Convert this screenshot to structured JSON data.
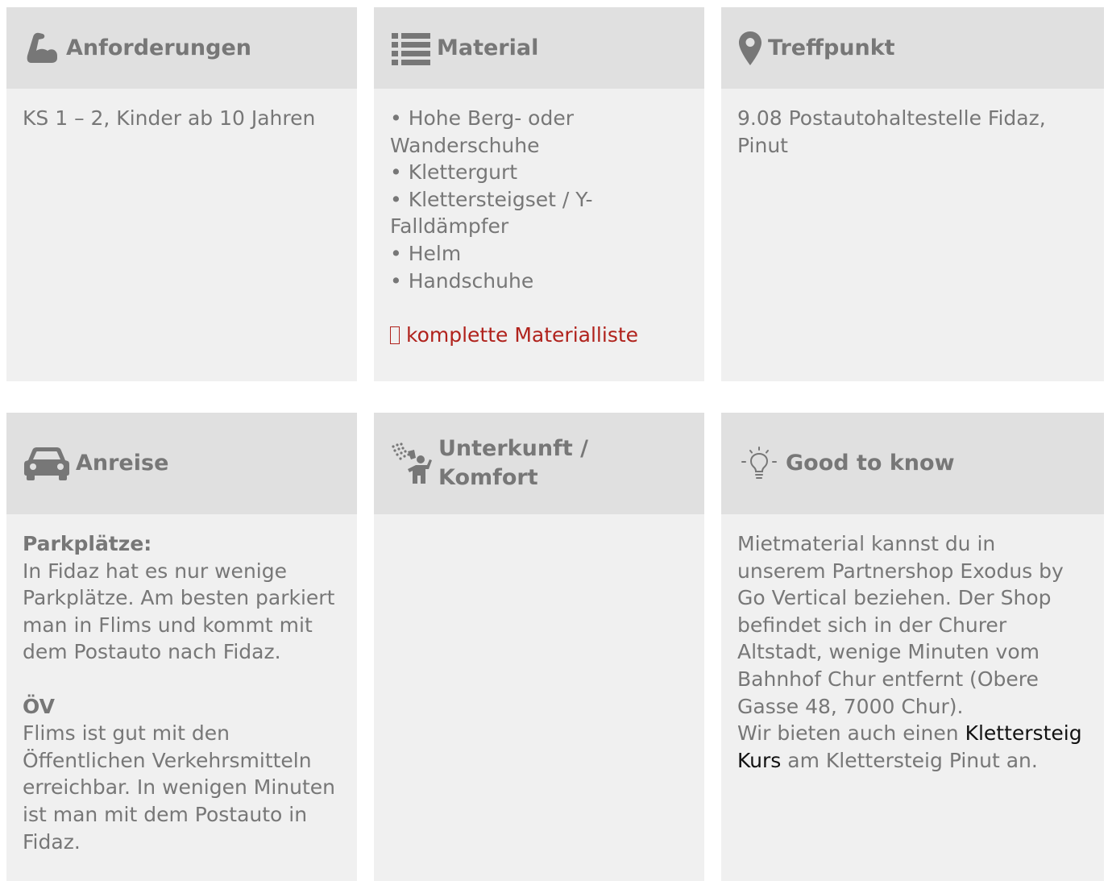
{
  "cards": {
    "anforderungen": {
      "title": "Anforderungen",
      "icon": "flexed-arm-icon",
      "text": "KS 1 – 2, Kinder ab 10 Jahren"
    },
    "material": {
      "title": "Material",
      "icon": "list-icon",
      "items": [
        "• Hohe Berg- oder Wanderschuhe",
        "• Klettergurt",
        "• Klettersteigset / Y-Falldämpfer",
        "• Helm",
        "• Handschuhe"
      ],
      "link_label": "komplette Materialliste",
      "link_icon": "missing-glyph-icon"
    },
    "treffpunkt": {
      "title": "Treffpunkt",
      "icon": "map-marker-icon",
      "text": "9.08 Postautohaltestelle Fidaz, Pinut"
    },
    "anreise": {
      "title": "Anreise",
      "icon": "car-icon",
      "parking_heading": "Parkplätze:",
      "parking_text": "In Fidaz hat es nur wenige Parkplätze. Am besten parkiert man in Flims und kommt mit dem Postauto nach Fidaz.",
      "oev_heading": "ÖV",
      "oev_text": "Flims ist gut mit den Öffentlichen Verkehrsmitteln erreichbar. In wenigen Minuten ist man mit dem Postauto in Fidaz."
    },
    "unterkunft": {
      "title": "Unterkunft / Komfort",
      "icon": "shower-icon"
    },
    "goodtoknow": {
      "title": "Good to know",
      "icon": "lightbulb-icon",
      "text_part1": "Mietmaterial kannst du in unserem Partnershop Exodus by Go Vertical beziehen. Der Shop befindet sich in der Churer Altstadt, wenige Minuten vom Bahnhof Chur entfernt (Obere Gasse 48, 7000 Chur).",
      "text_part2_before": "Wir bieten auch einen ",
      "link_label": "Klettersteig Kurs",
      "text_part2_after": " am Klettersteig Pinut an."
    }
  },
  "colors": {
    "card_bg": "#f0f0f0",
    "header_bg": "#e0e0e0",
    "text": "#777777",
    "link_red": "#b0221c",
    "link_black": "#111111"
  }
}
